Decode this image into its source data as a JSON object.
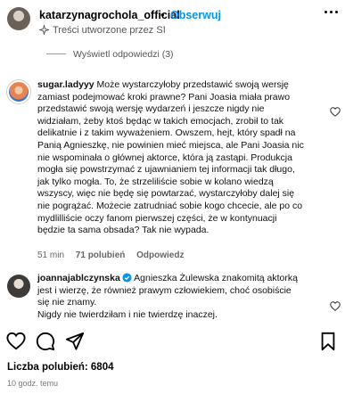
{
  "header": {
    "username": "katarzynagrochola_official",
    "separator": "•",
    "follow_label": "Obserwuj",
    "subtitle": "Treści utworzone przez SI"
  },
  "thread": {
    "view_replies_label": "Wyświetl odpowiedzi (3)"
  },
  "comments": [
    {
      "username": "sugar.ladyyy",
      "text_lines": [
        "Może wystarczyłoby przedstawić swoją wersję",
        "zamiast podejmować kroki prawne? Pani Joasia miała prawo",
        "przedstawić swoją wersję wydarzeń i jeszcze nigdy nie",
        "widziałam, żeby ktoś będąc w takich emocjach, zrobił to tak",
        "delikatnie i z takim wyważeniem. Owszem, hejt, który spadł na",
        "Panią Agnieszkę, nie powinien mieć miejsca, ale Pani Joasia nic",
        "nie wspominała o głównej aktorce, która ją zastąpi. Produkcja",
        "mogła się powstrzymać z ujawnianiem tej informacji tak długo,",
        "jak tylko mogła. To, że strzeliliście sobie w kolano wiedzą",
        "wszyscy, więc nie będę się powtarzać, wystarczyłoby dalej się",
        "nie pogrążać. Możecie zatrudniać sobie kogo chcecie, ale po co",
        "mydlilliście oczy fanom pierwszej części, że w kontynuacji",
        "będzie ta sama obsada? Tak nie wypada."
      ],
      "time": "51 min",
      "likes": "71 polubień",
      "reply_label": "Odpowiedz"
    },
    {
      "username": "joannajablczynska",
      "verified": true,
      "text_lines": [
        "Agnieszka Żulewska znakomitą aktorką",
        "jest i wierzę, że również prawym człowiekiem, choć osobiście",
        "się nie znamy.",
        "Nigdy nie twierdziłam i nie twierdzę inaczej."
      ]
    }
  ],
  "footer": {
    "likes_label": "Liczba polubień: 6804",
    "time_ago": "10 godz. temu"
  },
  "icons": {
    "like": "heart-icon",
    "comment": "comment-icon",
    "share": "send-icon",
    "save": "bookmark-icon",
    "more": "more-icon"
  },
  "colors": {
    "accent": "#0095f6",
    "verified": "#0095f6",
    "secondary_text": "#555555"
  }
}
